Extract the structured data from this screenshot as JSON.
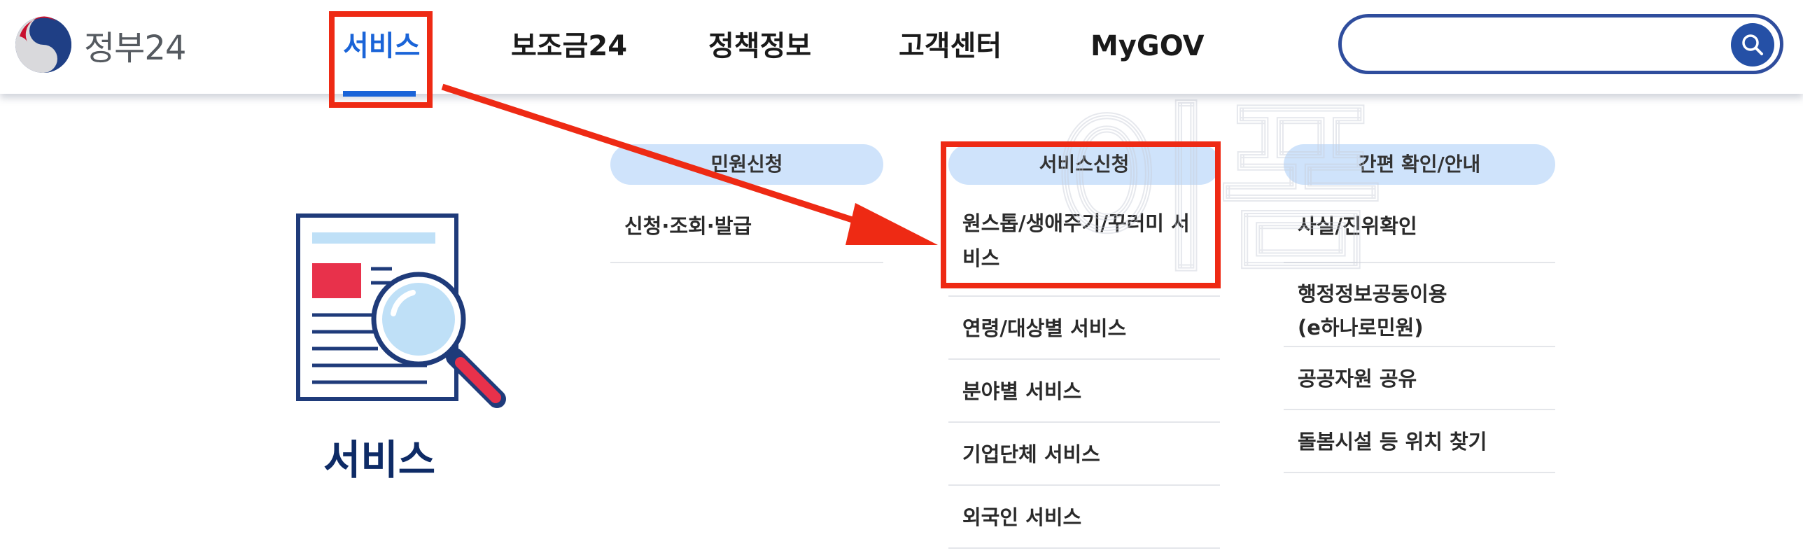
{
  "header": {
    "logo_text": "정부24",
    "nav": [
      {
        "label": "서비스",
        "active": true
      },
      {
        "label": "보조금24"
      },
      {
        "label": "정책정보"
      },
      {
        "label": "고객센터"
      },
      {
        "label": "MyGOV"
      }
    ],
    "search": {
      "placeholder": "",
      "value": "",
      "icon": "search-icon"
    }
  },
  "section": {
    "title": "서비스",
    "icon": "document-magnifier-icon"
  },
  "columns": [
    {
      "heading": "민원신청",
      "items": [
        "신청·조회·발급"
      ]
    },
    {
      "heading": "서비스신청",
      "items": [
        "원스톱/생애주기/꾸러미 서비스",
        "연령/대상별 서비스",
        "분야별 서비스",
        "기업단체 서비스",
        "외국인 서비스"
      ]
    },
    {
      "heading": "간편 확인/안내",
      "items": [
        "사실/진위확인",
        "행정정보공동이용(e하나로민원)",
        "공공자원 공유",
        "돌봄시설 등 위치 찾기"
      ]
    }
  ],
  "colors": {
    "accent": "#1a64d8",
    "navy": "#0e2b66",
    "pill": "#cfe3fb",
    "annotation": "#ee2a14",
    "search_border": "#2f4d9d"
  }
}
